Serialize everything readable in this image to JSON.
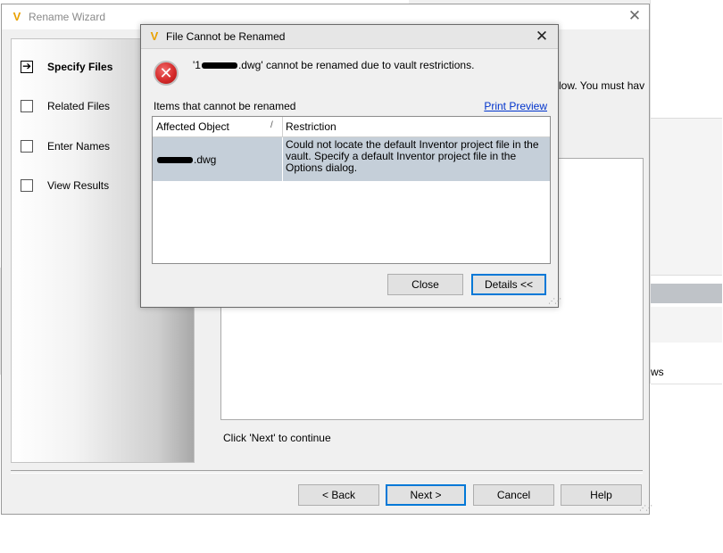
{
  "colors": {
    "accent": "#0078d7",
    "selected_row": "#c5cfd9",
    "error_red": "#d62b2b",
    "link": "#0033cc",
    "app_icon": "#e9a100"
  },
  "background": {
    "partial_right_text": "ws"
  },
  "wizard": {
    "title": "Rename Wizard",
    "app_icon_glyph": "V",
    "close_glyph": "✕",
    "steps": [
      {
        "label": "Specify Files",
        "current": true
      },
      {
        "label": "Related Files",
        "current": false
      },
      {
        "label": "Enter Names",
        "current": false
      },
      {
        "label": "View Results",
        "current": false
      }
    ],
    "current_arrow": "➔",
    "partial_instruction": "low.  You must hav",
    "continue_text": "Click 'Next' to continue",
    "buttons": {
      "back": "< Back",
      "next": "Next >",
      "cancel": "Cancel",
      "help": "Help"
    }
  },
  "dialog": {
    "title": "File Cannot be Renamed",
    "app_icon_glyph": "V",
    "close_glyph": "✕",
    "error_icon": "error-x-icon",
    "error_glyph": "✕",
    "message_prefix": "'1",
    "message_suffix": ".dwg' cannot be renamed due to vault restrictions.",
    "items_label": "Items that cannot be renamed",
    "print_preview": "Print Preview",
    "columns": [
      "Affected Object",
      "Restriction"
    ],
    "sort_glyph": "/",
    "rows": [
      {
        "object_suffix": ".dwg",
        "restriction": "Could not locate the default Inventor project file in the vault. Specify a default Inventor project file in the Options dialog."
      }
    ],
    "buttons": {
      "close": "Close",
      "details": "Details <<"
    }
  }
}
